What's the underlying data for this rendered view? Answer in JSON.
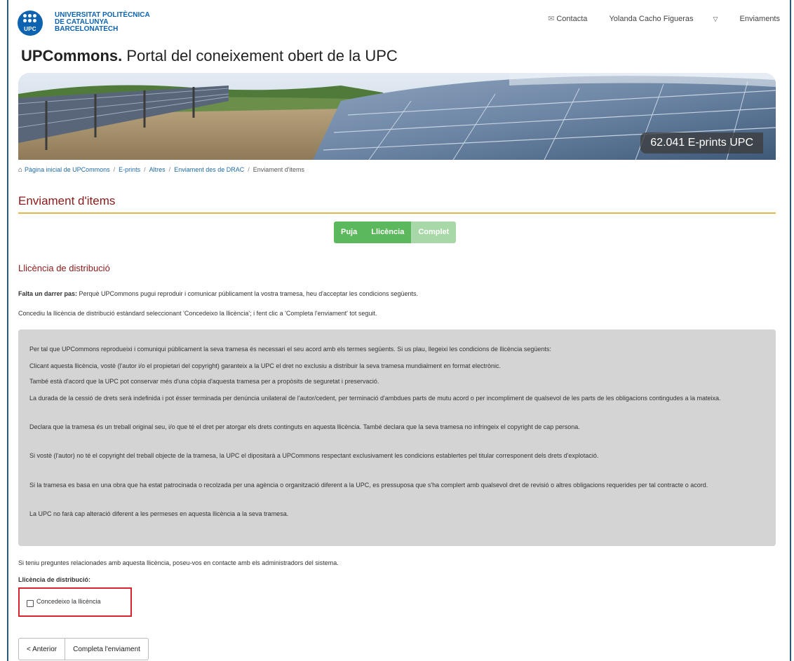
{
  "logo": {
    "line1": "UNIVERSITAT POLITÈCNICA",
    "line2": "DE CATALUNYA",
    "line3": "BARCELONATECH",
    "mark_text": "UPC"
  },
  "topnav": {
    "contact": "Contacta",
    "user": "Yolanda Cacho Figueras",
    "submissions": "Enviaments"
  },
  "site": {
    "title_bold": "UPCommons.",
    "title_rest": " Portal del coneixement obert de la UPC"
  },
  "banner": {
    "eprints": "62.041 E-prints UPC"
  },
  "breadcrumb": {
    "items": [
      "Pàgina inicial de UPCommons",
      "E-prints",
      "Altres",
      "Enviament des de DRAC"
    ],
    "current": "Enviament d'items"
  },
  "page": {
    "title": "Enviament d'items"
  },
  "steps": [
    "Puja",
    "Llicència",
    "Complet"
  ],
  "section": {
    "title": "Llicència de distribució",
    "intro_bold": "Falta un darrer pas:",
    "intro_rest": " Perquè UPCommons pugui reproduir i comunicar públicament la vostra tramesa, heu d'acceptar les condicions següents.",
    "instruction": "Concediu la llicència de distribució estàndard seleccionant 'Concedeixo la llicència'; i fent clic a 'Completa l'enviament' tot seguit."
  },
  "license_text": [
    "Per tal que UPCommons reprodueixi i comuniqui públicament la seva tramesa és necessari el seu acord amb els termes següents. Si us plau, llegeixi les condicions de llicència següents:",
    "Clicant aquesta llicència, vostè (l'autor i/o el propietari del copyright) garanteix a la UPC el dret no exclusiu a distribuir la seva tramesa mundialment en format electrònic.",
    "També està d'acord que la UPC pot conservar més d'una còpia d'aquesta tramesa per a propòsits de seguretat i preservació.",
    "La durada de la cessió de drets serà indefinida i pot ésser terminada per denúncia unilateral de l'autor/cedent, per terminació d'ambdues parts de mutu acord o per incompliment de qualsevol de les parts de les obligacions contingudes a la mateixa.",
    "Declara que la tramesa és un treball original seu, i/o que té el dret per atorgar els drets continguts en aquesta llicència. També declara que la seva tramesa no infringeix el copyright de cap persona.",
    "Si vostè (l'autor) no té el copyright del treball objecte de la tramesa, la UPC el dipositarà a UPCommons respectant exclusivament les condicions establertes pel titular corresponent dels drets d'explotació.",
    "Si la tramesa es basa en una obra que ha estat patrocinada o recolzada per una agència o organització diferent a la UPC, es pressuposa que s'ha complert amb qualsevol dret de revisió o altres obligacions requerides per tal contracte o acord.",
    "La UPC no farà cap alteració diferent a les permeses en aquesta llicència a la seva tramesa."
  ],
  "contact_note": "Si teniu preguntes relacionades amb aquesta llicència, poseu-vos en contacte amb els administradors del sistema.",
  "field": {
    "label": "Llicència de distribució:",
    "checkbox_label": "Concedeixo la llicència",
    "checked": false
  },
  "buttons": {
    "previous": "< Anterior",
    "complete": "Completa l'enviament"
  },
  "colors": {
    "brand_blue": "#0d63b0",
    "title_red": "#8b1a1a",
    "rule_gold": "#e2b84d",
    "step_green": "#5cb85c",
    "step_green_light": "#a8d8a8",
    "highlight_red": "#d9232d",
    "license_bg": "#d4d4d4"
  }
}
